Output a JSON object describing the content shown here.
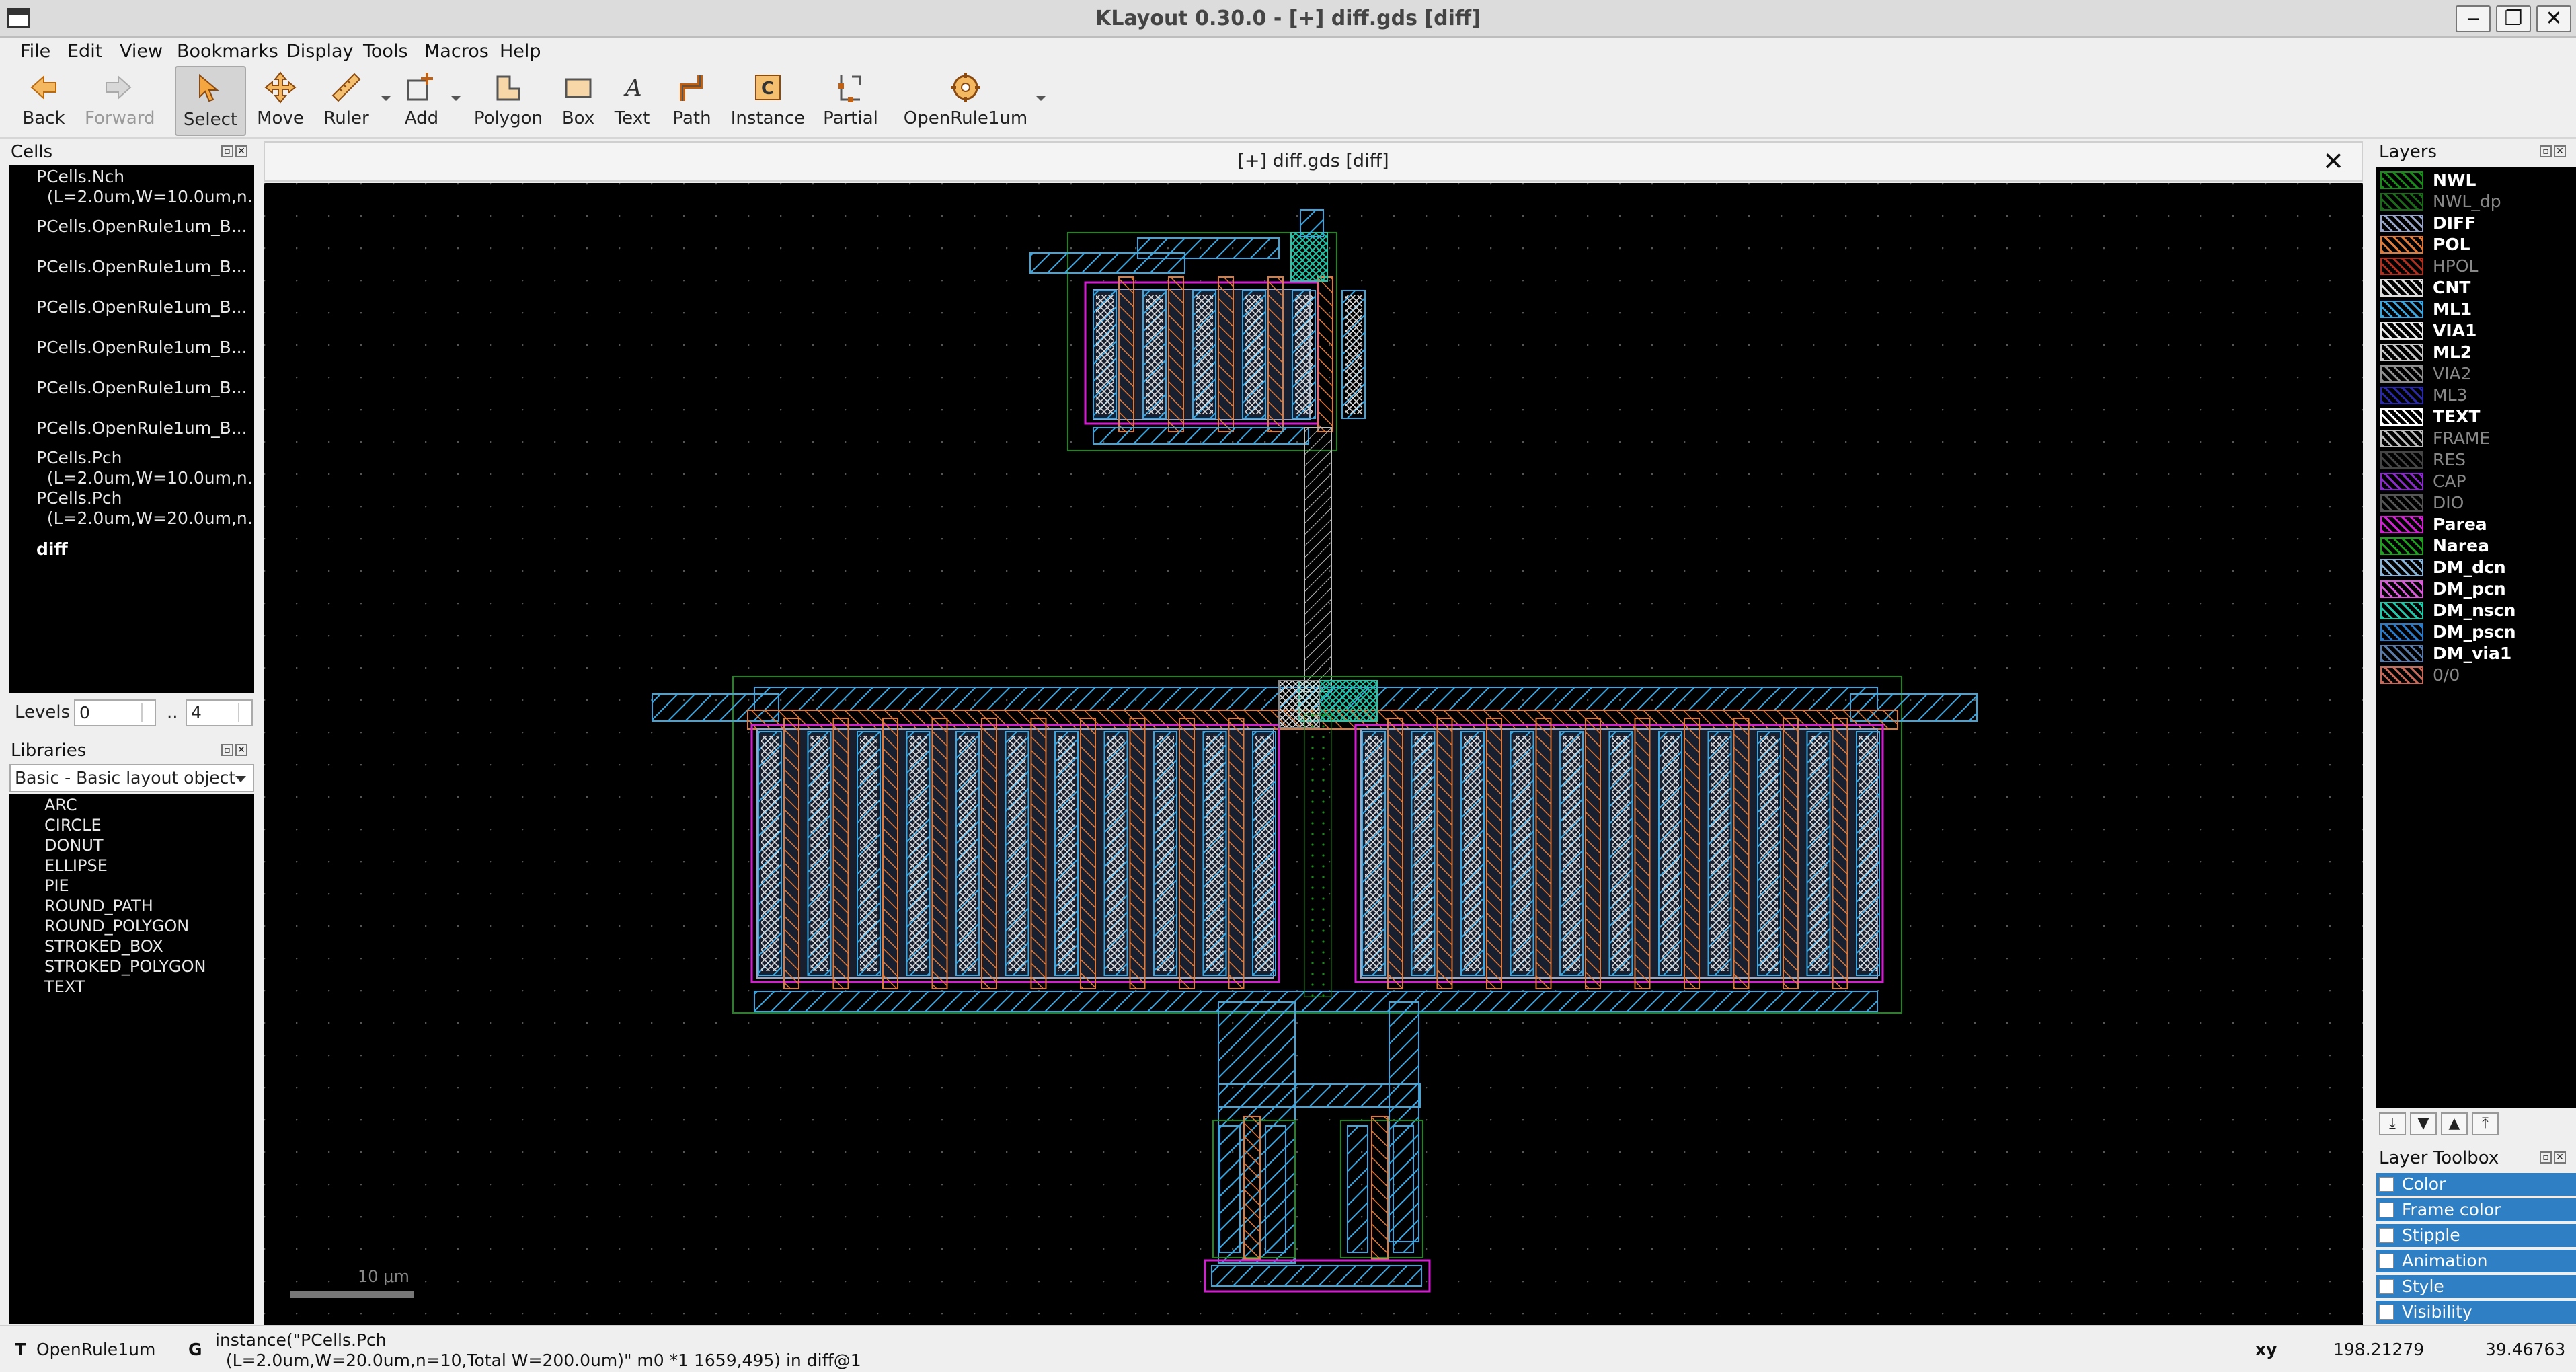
{
  "window": {
    "title": "KLayout 0.30.0 - [+] diff.gds [diff]",
    "controls": [
      "‒",
      "❐",
      "✕"
    ]
  },
  "menubar": [
    "File",
    "Edit",
    "View",
    "Bookmarks",
    "Display",
    "Tools",
    "Macros",
    "Help"
  ],
  "toolbar": {
    "back": "Back",
    "forward": "Forward",
    "select": "Select",
    "move": "Move",
    "ruler": "Ruler",
    "add": "Add",
    "polygon": "Polygon",
    "box": "Box",
    "text": "Text",
    "path": "Path",
    "instance": "Instance",
    "partial": "Partial",
    "pdk": "OpenRule1um"
  },
  "cells_panel": {
    "title": "Cells",
    "items": [
      "PCells.Nch\n  (L=2.0um,W=10.0um,n...",
      "PCells.OpenRule1um_B...",
      "PCells.OpenRule1um_B...",
      "PCells.OpenRule1um_B...",
      "PCells.OpenRule1um_B...",
      "PCells.OpenRule1um_B...",
      "PCells.OpenRule1um_B...",
      "PCells.Pch\n  (L=2.0um,W=10.0um,n...",
      "PCells.Pch\n  (L=2.0um,W=20.0um,n...",
      "diff"
    ]
  },
  "levels": {
    "label": "Levels",
    "from": "0",
    "sep": "..",
    "to": "4"
  },
  "libraries_panel": {
    "title": "Libraries",
    "selected": "Basic - Basic layout object",
    "items": [
      "ARC",
      "CIRCLE",
      "DONUT",
      "ELLIPSE",
      "PIE",
      "ROUND_PATH",
      "ROUND_POLYGON",
      "STROKED_BOX",
      "STROKED_POLYGON",
      "TEXT"
    ]
  },
  "document_tab": {
    "title": "[+] diff.gds [diff]",
    "close": "✕"
  },
  "scale_bar": "10 μm",
  "layers_panel": {
    "title": "Layers",
    "layers": [
      {
        "name": "NWL",
        "color": "#1a8a1a",
        "visible": true
      },
      {
        "name": "NWL_dp",
        "color": "#1a6a1a",
        "visible": false
      },
      {
        "name": "DIFF",
        "color": "#9aa6c8",
        "visible": true
      },
      {
        "name": "POL",
        "color": "#e07a3a",
        "visible": true
      },
      {
        "name": "HPOL",
        "color": "#b03020",
        "visible": false
      },
      {
        "name": "CNT",
        "color": "#dddddd",
        "visible": true
      },
      {
        "name": "ML1",
        "color": "#3ca6e0",
        "visible": true
      },
      {
        "name": "VIA1",
        "color": "#e8e8e8",
        "visible": true
      },
      {
        "name": "ML2",
        "color": "#c8c8c8",
        "visible": true
      },
      {
        "name": "VIA2",
        "color": "#909090",
        "visible": false
      },
      {
        "name": "ML3",
        "color": "#2a2aa8",
        "visible": false
      },
      {
        "name": "TEXT",
        "color": "#ffffff",
        "visible": true
      },
      {
        "name": "FRAME",
        "color": "#bbbbbb",
        "visible": false
      },
      {
        "name": "RES",
        "color": "#444444",
        "visible": false
      },
      {
        "name": "CAP",
        "color": "#8a2ac8",
        "visible": false
      },
      {
        "name": "DIO",
        "color": "#555555",
        "visible": false
      },
      {
        "name": "Parea",
        "color": "#d020d0",
        "visible": true
      },
      {
        "name": "Narea",
        "color": "#20a020",
        "visible": true
      },
      {
        "name": "DM_dcn",
        "color": "#8ab4d8",
        "visible": true
      },
      {
        "name": "DM_pcn",
        "color": "#d85ad8",
        "visible": true
      },
      {
        "name": "DM_nscn",
        "color": "#20c8a8",
        "visible": true
      },
      {
        "name": "DM_pscn",
        "color": "#2a7ac8",
        "visible": true
      },
      {
        "name": "DM_via1",
        "color": "#5a7aa8",
        "visible": true
      },
      {
        "name": "0/0",
        "color": "#c86a5a",
        "visible": false
      }
    ]
  },
  "layer_toolbox": {
    "title": "Layer Toolbox",
    "rows": [
      "Color",
      "Frame color",
      "Stipple",
      "Animation",
      "Style",
      "Visibility"
    ]
  },
  "status": {
    "tech_flag": "T",
    "tech": "OpenRule1um",
    "geom_flag": "G",
    "message": "instance(\"PCells.Pch\n  (L=2.0um,W=20.0um,n=10,Total W=200.0um)\" m0 *1 1659,495) in diff@1",
    "coord_label": "xy",
    "x": "198.21279",
    "y": "39.46763"
  }
}
